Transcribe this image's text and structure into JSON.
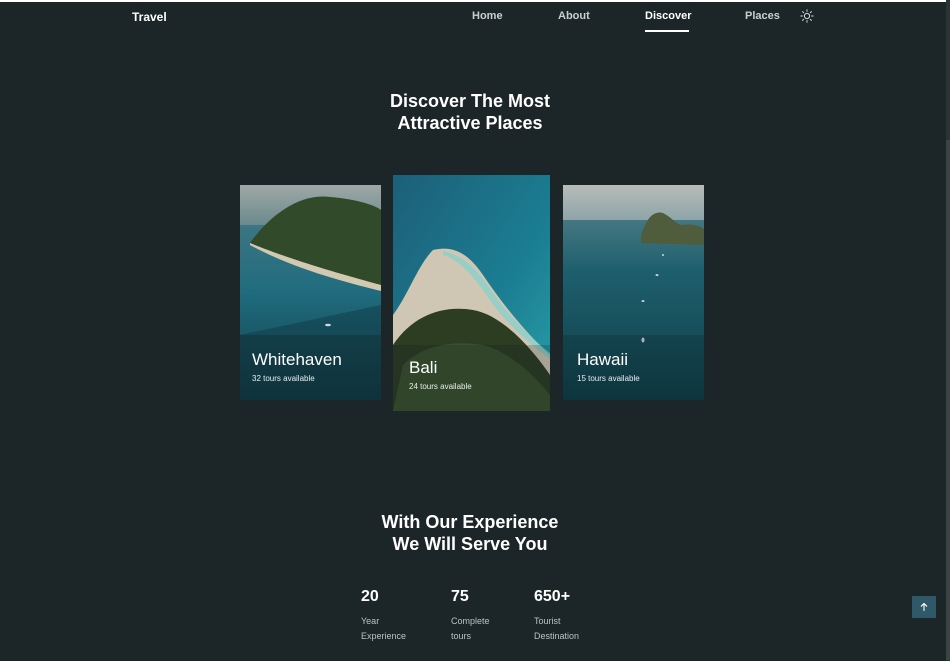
{
  "header": {
    "brand": "Travel",
    "nav": [
      {
        "label": "Home",
        "active": false
      },
      {
        "label": "About",
        "active": false
      },
      {
        "label": "Discover",
        "active": true
      },
      {
        "label": "Places",
        "active": false
      }
    ],
    "theme_icon": "sun-icon"
  },
  "discover": {
    "title_line1": "Discover The Most",
    "title_line2": "Attractive Places",
    "cards": [
      {
        "name": "Whitehaven",
        "tours": "32 tours available"
      },
      {
        "name": "Bali",
        "tours": "24 tours available"
      },
      {
        "name": "Hawaii",
        "tours": "15 tours available"
      }
    ]
  },
  "experience": {
    "title_line1": "With Our Experience",
    "title_line2": "We Will Serve You",
    "stats": [
      {
        "number": "20",
        "label_line1": "Year",
        "label_line2": "Experience"
      },
      {
        "number": "75",
        "label_line1": "Complete",
        "label_line2": "tours"
      },
      {
        "number": "650+",
        "label_line1": "Tourist",
        "label_line2": "Destination"
      }
    ]
  },
  "scroll_top_icon": "arrow-up-icon",
  "colors": {
    "background": "#1c2629",
    "scroll_button": "#2f5868"
  }
}
